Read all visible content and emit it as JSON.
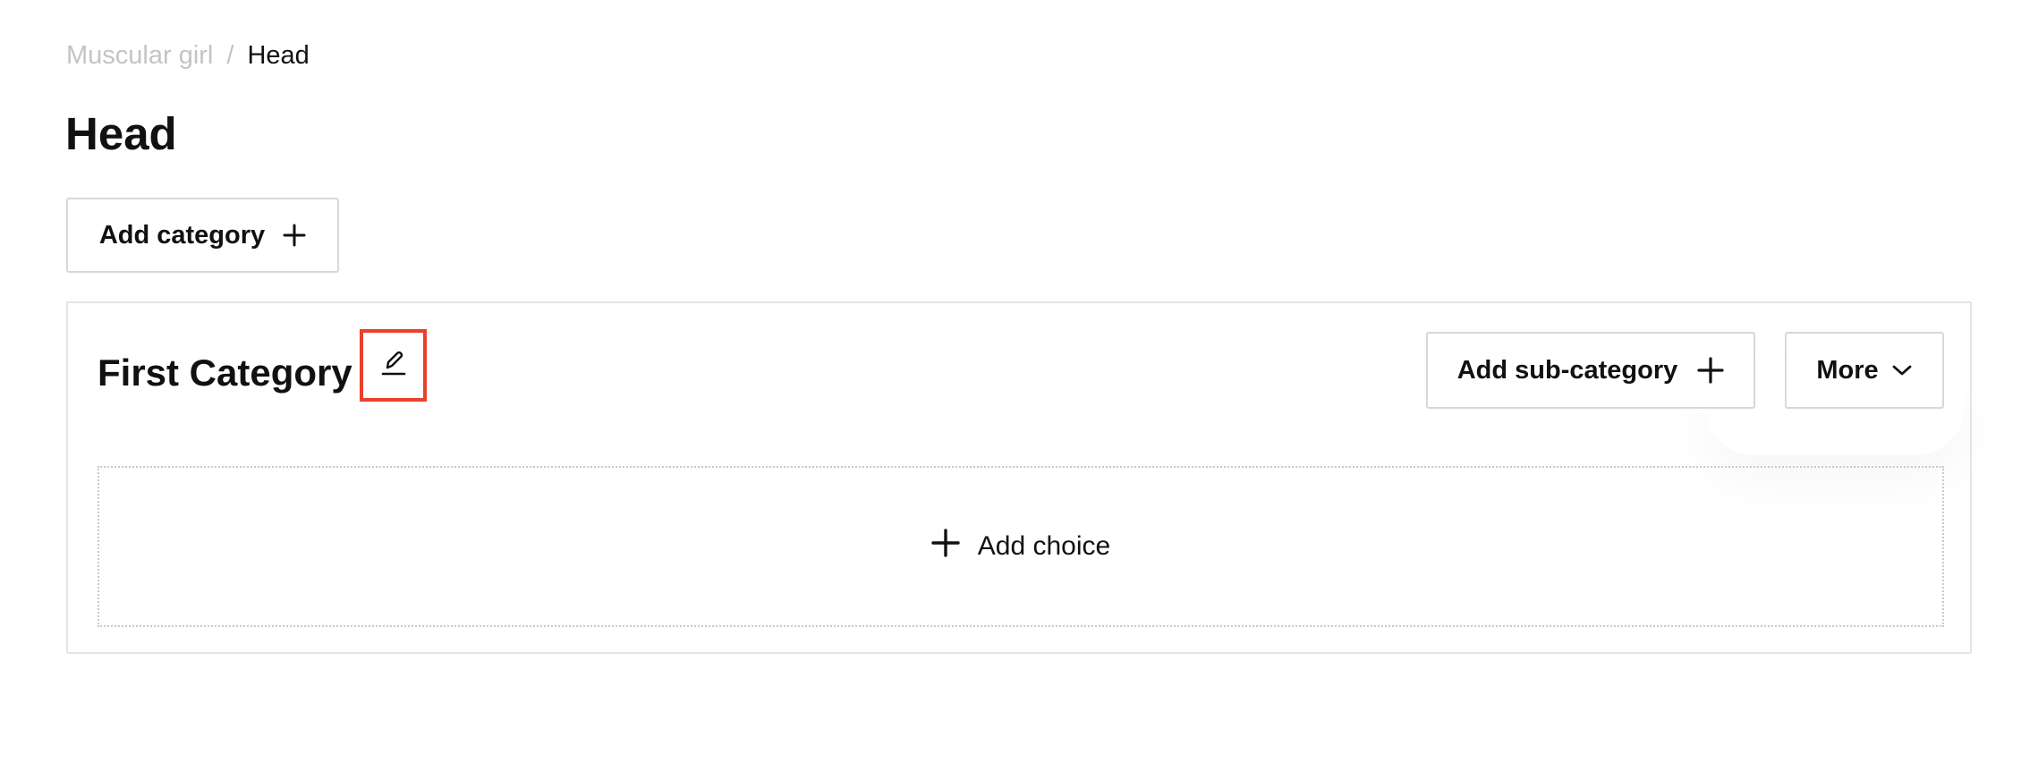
{
  "breadcrumb": {
    "parent": "Muscular girl",
    "separator": "/",
    "current": "Head"
  },
  "page_title": "Head",
  "actions": {
    "add_category_label": "Add category"
  },
  "category": {
    "title": "First Category",
    "add_subcategory_label": "Add sub-category",
    "more_label": "More",
    "add_choice_label": "Add choice"
  },
  "colors": {
    "highlight": "#e8412c",
    "muted_text": "#c4c4c4",
    "border": "#d8d8d8"
  },
  "icons": {
    "edit": "pencil-icon",
    "add": "plus-icon",
    "more": "chevron-down-icon"
  }
}
